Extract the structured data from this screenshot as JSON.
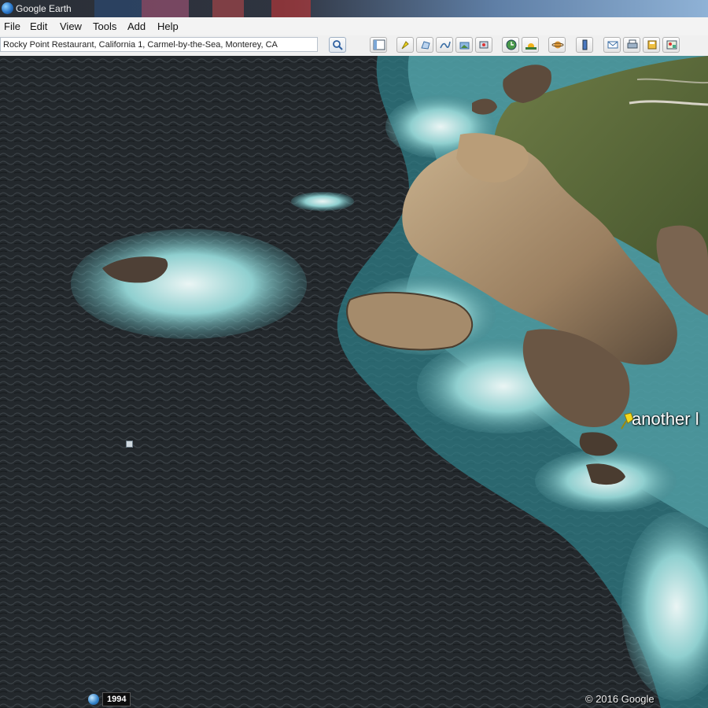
{
  "window": {
    "title": "Google Earth"
  },
  "menu": {
    "items": [
      "File",
      "Edit",
      "View",
      "Tools",
      "Add",
      "Help"
    ]
  },
  "search": {
    "value": "Rocky Point Restaurant, California 1, Carmel-by-the-Sea, Monterey, CA"
  },
  "toolbar": {
    "buttons": [
      "sidebar-toggle-icon",
      "placemark-icon",
      "polygon-icon",
      "path-icon",
      "image-overlay-icon",
      "record-tour-icon",
      "historical-imagery-icon",
      "sunlight-icon",
      "planets-icon",
      "ruler-icon",
      "email-icon",
      "print-icon",
      "save-image-icon",
      "view-in-maps-icon"
    ]
  },
  "map": {
    "placemark_label": "another l",
    "copyright": "© 2016 Google",
    "history_year": "1994"
  },
  "colors": {
    "ocean": "#22272b",
    "surf": "#3f9aa3",
    "foam": "#e8f3f2",
    "rock": "#a48a6c",
    "grass": "#5b6a3a",
    "placemark": "#f3d91c"
  }
}
